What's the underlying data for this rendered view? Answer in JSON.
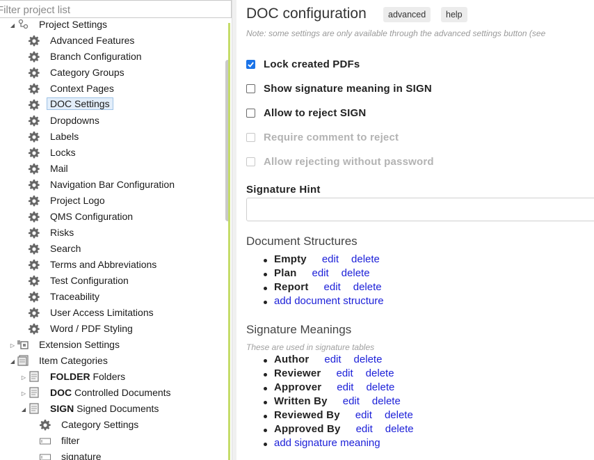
{
  "tree": {
    "filter_placeholder": "Filter project list",
    "project_settings": "Project Settings",
    "settings_items": [
      "Advanced Features",
      "Branch Configuration",
      "Category Groups",
      "Context Pages",
      "DOC Settings",
      "Dropdowns",
      "Labels",
      "Locks",
      "Mail",
      "Navigation Bar Configuration",
      "Project Logo",
      "QMS Configuration",
      "Risks",
      "Search",
      "Terms and Abbreviations",
      "Test Configuration",
      "Traceability",
      "User Access Limitations",
      "Word / PDF Styling"
    ],
    "selected_item": "DOC Settings",
    "extension_settings": "Extension Settings",
    "item_categories": "Item Categories",
    "categories": [
      {
        "code": "FOLDER",
        "name": "Folders"
      },
      {
        "code": "DOC",
        "name": "Controlled Documents"
      },
      {
        "code": "SIGN",
        "name": "Signed Documents"
      }
    ],
    "sign_children": [
      "Category Settings",
      "filter",
      "signature"
    ]
  },
  "main": {
    "title": "DOC configuration",
    "advanced_button": "advanced",
    "help_button": "help",
    "note": "Note: some settings are only available through the advanced settings button (see",
    "options": [
      {
        "label": "Lock created PDFs",
        "checked": true,
        "disabled": false
      },
      {
        "label": "Show signature meaning in SIGN",
        "checked": false,
        "disabled": false
      },
      {
        "label": "Allow to reject SIGN",
        "checked": false,
        "disabled": false
      },
      {
        "label": "Require comment to reject",
        "checked": false,
        "disabled": true
      },
      {
        "label": "Allow rejecting without password",
        "checked": false,
        "disabled": true
      }
    ],
    "signature_hint_label": "Signature Hint",
    "signature_hint_value": "",
    "document_structures_title": "Document Structures",
    "document_structures": [
      "Empty",
      "Plan",
      "Report"
    ],
    "add_document_structure": "add document structure",
    "signature_meanings_title": "Signature Meanings",
    "signature_meanings_note": "These are used in signature tables",
    "signature_meanings": [
      "Author",
      "Reviewer",
      "Approver",
      "Written By",
      "Reviewed By",
      "Approved By"
    ],
    "add_signature_meaning": "add signature meaning",
    "edit_label": "edit",
    "delete_label": "delete"
  },
  "colors": {
    "link": "#1b1fd8",
    "checkbox_checked": "#1a73e8",
    "tree_accent": "#c5dc6a"
  }
}
